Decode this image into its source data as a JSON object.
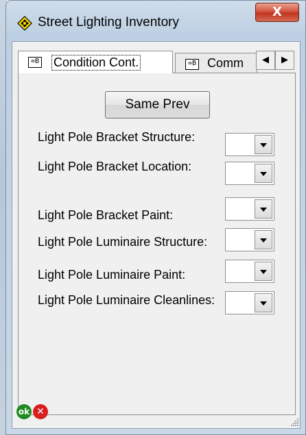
{
  "window": {
    "title": "Street Lighting Inventory",
    "close_glyph": "X"
  },
  "tabs": {
    "active_label": "Condition Cont.",
    "inactive_label": "Comm",
    "icon_glyph": "=B",
    "scroll_left_glyph": "◀",
    "scroll_right_glyph": "▶"
  },
  "form": {
    "same_prev_label": "Same Prev",
    "fields": [
      {
        "label": "Light Pole Bracket Structure:",
        "value": ""
      },
      {
        "label": "Light Pole Bracket Location:",
        "value": ""
      },
      {
        "label": "Light Pole Bracket Paint:",
        "value": ""
      },
      {
        "label": "Light Pole Luminaire Structure:",
        "value": ""
      },
      {
        "label": "Light Pole Luminaire Paint:",
        "value": ""
      },
      {
        "label": "Light Pole Luminaire Cleanlines:",
        "value": ""
      }
    ]
  },
  "footer": {
    "ok_glyph": "ok",
    "cancel_glyph": "✕"
  },
  "icons": {
    "app": "diamond-arrows-icon",
    "tab": "form-icon",
    "ok": "ok-icon",
    "cancel": "cancel-icon"
  },
  "colors": {
    "close_button": "#c0341f",
    "ok": "#1f8a1f",
    "cancel": "#d81e1e"
  }
}
